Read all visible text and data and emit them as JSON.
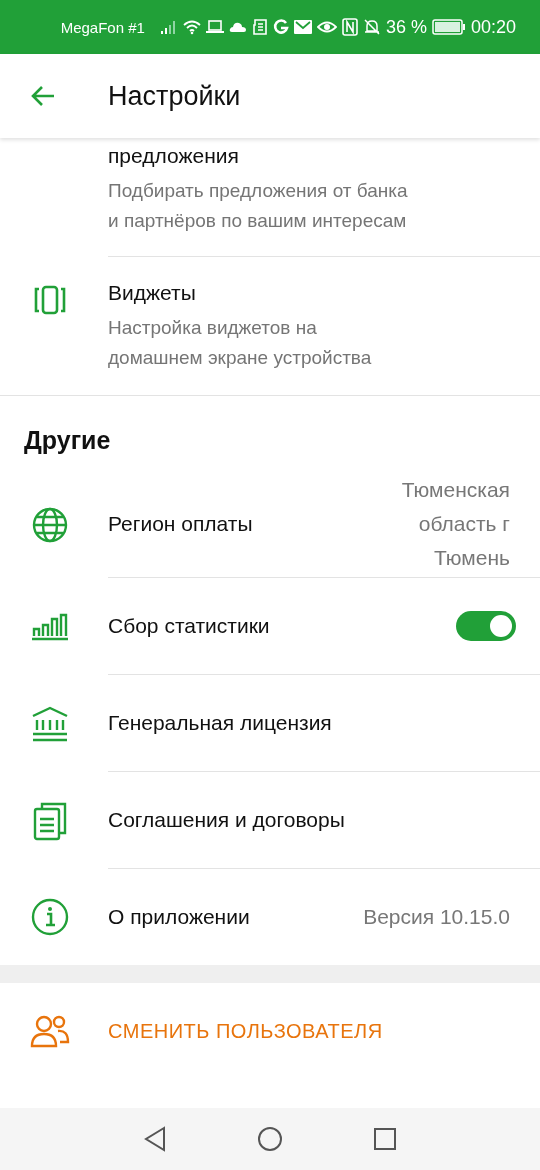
{
  "status_bar": {
    "carrier": "MegaFon #1",
    "battery": "36 %",
    "time": "00:20"
  },
  "header": {
    "title": "Настройки"
  },
  "top_items": [
    {
      "title": "предложения",
      "description": "Подбирать предложения от банка и партнёров по вашим интересам"
    },
    {
      "title": "Виджеты",
      "description": "Настройка виджетов на домашнем экране устройства"
    }
  ],
  "section": {
    "title": "Другие"
  },
  "items": [
    {
      "kind": "value",
      "title": "Регион оплаты",
      "value": "Тюменская область г Тюмень"
    },
    {
      "kind": "toggle",
      "title": "Сбор статистики",
      "on": true
    },
    {
      "kind": "link",
      "title": "Генеральная лицензия"
    },
    {
      "kind": "link",
      "title": "Соглашения и договоры"
    },
    {
      "kind": "value",
      "title": "О приложении",
      "value": "Версия 10.15.0"
    }
  ],
  "action": {
    "label": "СМЕНИТЬ ПОЛЬЗОВАТЕЛЯ"
  }
}
